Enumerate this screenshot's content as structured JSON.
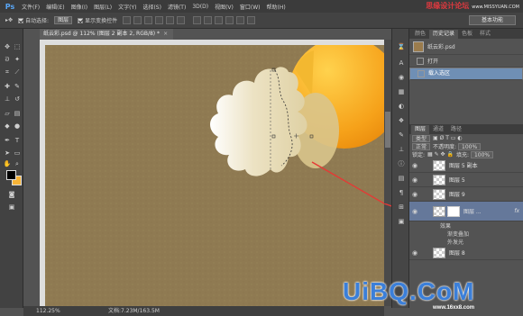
{
  "app": {
    "logo": "Ps"
  },
  "menu": [
    "文件(F)",
    "编辑(E)",
    "图像(I)",
    "图层(L)",
    "文字(Y)",
    "选择(S)",
    "滤镜(T)",
    "3D(D)",
    "视图(V)",
    "窗口(W)",
    "帮助(H)"
  ],
  "brand": {
    "text": "思缘设计论坛",
    "url": "www.MISSYUAN.COM"
  },
  "options": {
    "auto_select_label": "自动选择:",
    "auto_select_value": "图层",
    "show_transform_label": "显示变换控件",
    "workspace": "基本功能"
  },
  "document": {
    "tab": "纸云彩.psd @ 112% (图层 2 副本 2, RGB/8) *",
    "close": "×"
  },
  "status": {
    "zoom": "112.25%",
    "doc_size": "文档:7.23M/163.5M"
  },
  "history": {
    "tabs": [
      "颜色",
      "历史记录",
      "色板",
      "样式"
    ],
    "active_tab": "历史记录",
    "snapshot": "纸云彩.psd",
    "steps": [
      "打开",
      "载入选区"
    ],
    "selected_step": "载入选区"
  },
  "layers_panel": {
    "tabs": [
      "图层",
      "通道",
      "路径"
    ],
    "filter_label": "类型",
    "blend_mode": "正常",
    "opacity_label": "不透明度:",
    "opacity": "100%",
    "lock_label": "锁定:",
    "fill_label": "填充:",
    "fill": "100%",
    "layers": [
      {
        "name": "图层 5 副本",
        "active": false
      },
      {
        "name": "图层 5",
        "active": false
      },
      {
        "name": "图层 9",
        "active": false
      },
      {
        "name": "图层 ...",
        "active": true,
        "fx": "fx"
      }
    ],
    "effects_label": "效果",
    "effects": [
      "渐变叠加",
      "外发光"
    ],
    "last_layer": "图层 8"
  },
  "watermark": {
    "main": "UiBQ.CoM",
    "sub": "www.16xx8.com"
  },
  "colors": {
    "foreground": "#000000",
    "background": "#f6b337",
    "canvas": "#8f7a52",
    "accent": "#e53935"
  }
}
